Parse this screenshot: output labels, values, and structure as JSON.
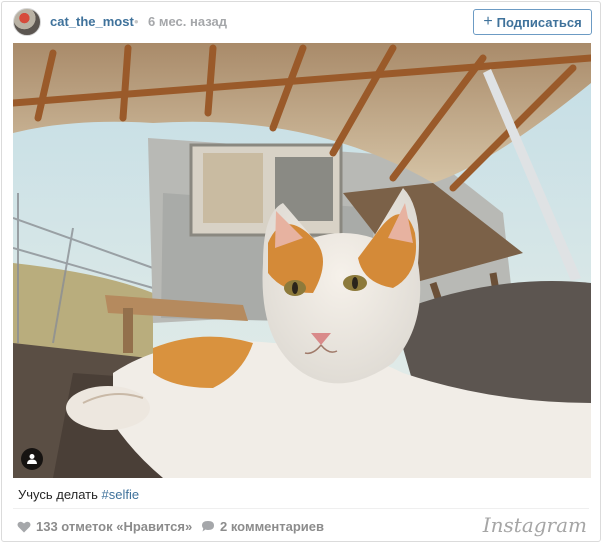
{
  "post": {
    "username": "cat_the_most",
    "separator": "•",
    "time_ago": "6 мес. назад",
    "follow_label": "Подписаться",
    "caption_text": "Учусь делать ",
    "hashtag": "#selfie",
    "likes_label": "133 отметок «Нравится»",
    "comments_label": "2 комментариев",
    "brand": "Instagram"
  },
  "icons": {
    "avatar": "avatar",
    "follow": "plus-icon",
    "user_tag": "user-tag-icon",
    "likes": "heart-icon",
    "comments": "comment-bubble-icon"
  },
  "colors": {
    "link": "#3f729b",
    "muted": "#8c8c8c",
    "border": "#dbdbdb"
  }
}
